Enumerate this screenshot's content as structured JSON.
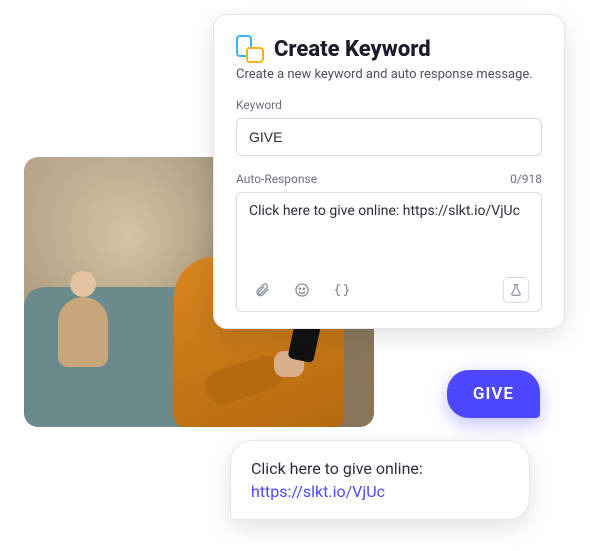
{
  "card": {
    "title": "Create Keyword",
    "subtitle": "Create a new keyword and auto response message.",
    "keyword_label": "Keyword",
    "keyword_value": "GIVE",
    "response_label": "Auto-Response",
    "counter": "0/918",
    "response_value": "Click here to give online: https://slkt.io/VjUc"
  },
  "chat": {
    "outgoing": "GIVE",
    "incoming_text": "Click here to give online:",
    "incoming_link": "https://slkt.io/VjUc"
  }
}
